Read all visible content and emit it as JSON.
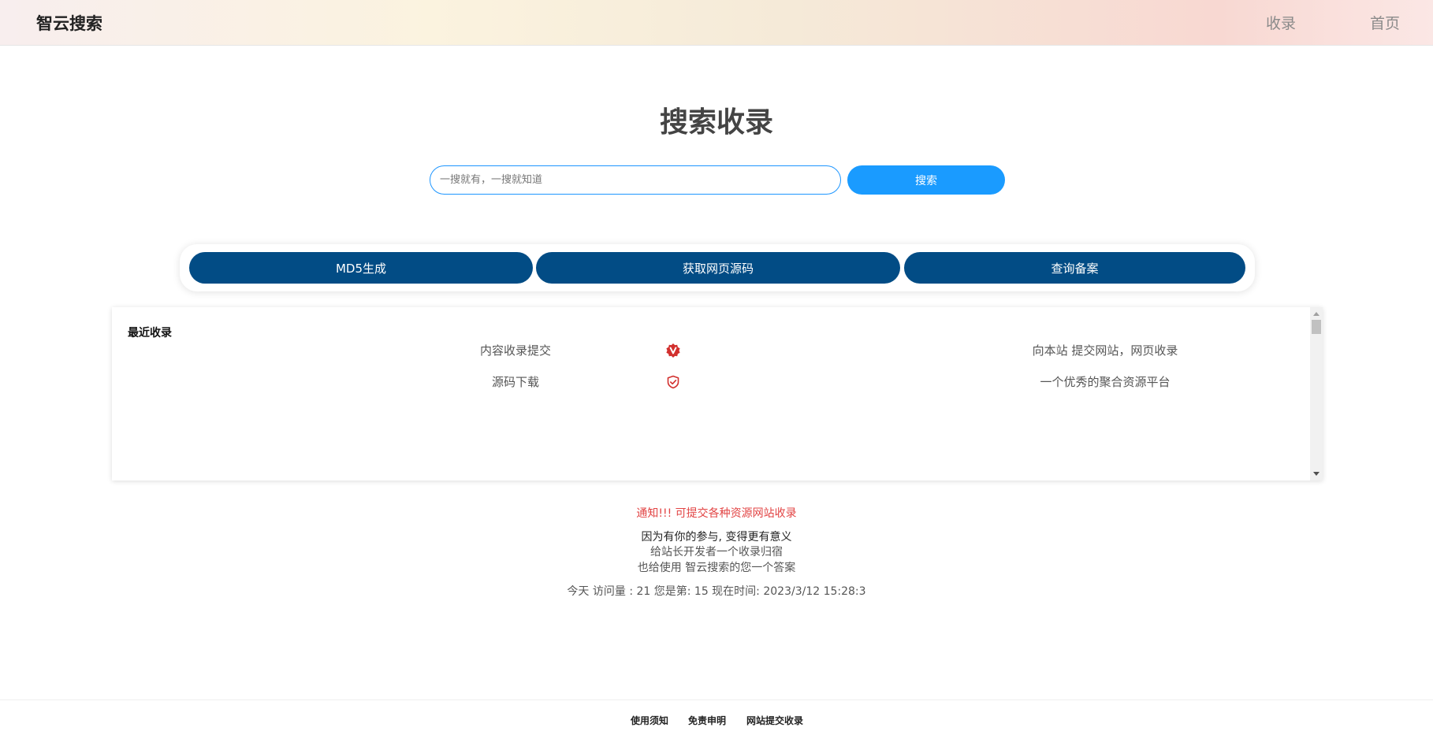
{
  "header": {
    "brand": "智云搜索",
    "nav": {
      "collect": "收录",
      "home": "首页"
    }
  },
  "main": {
    "title": "搜索收录",
    "search": {
      "placeholder": "一搜就有，一搜就知道",
      "value": "",
      "button": "搜索"
    }
  },
  "tools": {
    "md5": "MD5生成",
    "source": "获取网页源码",
    "beian": "查询备案"
  },
  "recent": {
    "title": "最近收录",
    "rows": [
      {
        "name": "内容收录提交",
        "icon": "verified-badge-icon",
        "desc": "向本站 提交网站，网页收录"
      },
      {
        "name": "源码下载",
        "icon": "shield-check-icon",
        "desc": "一个优秀的聚合资源平台"
      }
    ]
  },
  "info": {
    "notice": "通知!!! 可提交各种资源网站收录",
    "slogan_1": "因为有你的参与, 变得更有意义",
    "slogan_2": "给站长开发者一个收录归宿",
    "slogan_3": "也给使用 智云搜索的您一个答案",
    "stats": "今天 访问量 : 21 您是第: 15 现在时间: 2023/3/12 15:28:3"
  },
  "footer": {
    "usage": "使用须知",
    "disclaimer": "免责申明",
    "submit": "网站提交收录"
  },
  "colors": {
    "accent": "#1a9bff",
    "tool": "#024c85",
    "notice": "#e24444",
    "icon": "#d2302e"
  }
}
